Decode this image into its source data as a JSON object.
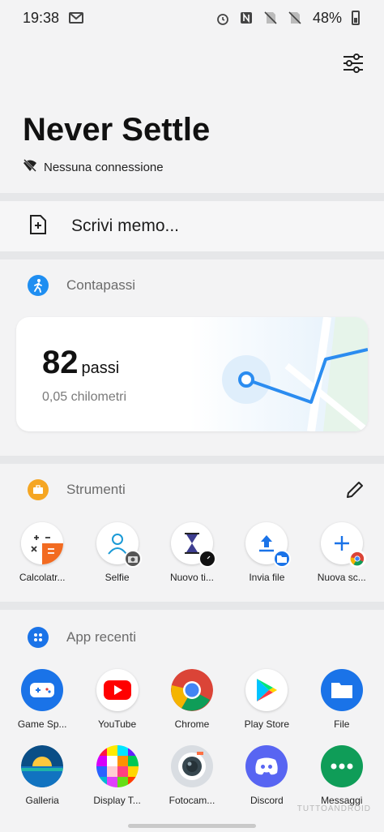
{
  "status_bar": {
    "time": "19:38",
    "battery": "48%",
    "icons": [
      "gmail-icon",
      "alarm-icon",
      "nfc-icon",
      "no-sim-icon",
      "no-sim-icon",
      "battery-icon"
    ]
  },
  "header": {
    "title": "Never Settle",
    "wifi_status": "Nessuna connessione"
  },
  "memo": {
    "label": "Scrivi memo..."
  },
  "steps": {
    "section_title": "Contapassi",
    "count": "82",
    "unit": "passi",
    "distance": "0,05 chilometri"
  },
  "tools": {
    "section_title": "Strumenti",
    "items": [
      {
        "label": "Calcolatr...",
        "icon": "calculator-icon"
      },
      {
        "label": "Selfie",
        "icon": "selfie-icon"
      },
      {
        "label": "Nuovo ti...",
        "icon": "timer-icon"
      },
      {
        "label": "Invia file",
        "icon": "send-file-icon"
      },
      {
        "label": "Nuova sc...",
        "icon": "new-tab-icon"
      }
    ]
  },
  "recent_apps": {
    "section_title": "App recenti",
    "row1": [
      {
        "label": "Game Sp...",
        "icon": "game-space-icon"
      },
      {
        "label": "YouTube",
        "icon": "youtube-icon"
      },
      {
        "label": "Chrome",
        "icon": "chrome-icon"
      },
      {
        "label": "Play Store",
        "icon": "play-store-icon"
      },
      {
        "label": "File",
        "icon": "file-icon"
      }
    ],
    "row2": [
      {
        "label": "Galleria",
        "icon": "gallery-icon"
      },
      {
        "label": "Display T...",
        "icon": "display-test-icon"
      },
      {
        "label": "Fotocam...",
        "icon": "camera-icon"
      },
      {
        "label": "Discord",
        "icon": "discord-icon"
      },
      {
        "label": "Messaggi",
        "icon": "messages-icon"
      }
    ]
  },
  "watermark": "TUTTOANDROID",
  "colors": {
    "accent_blue": "#1a73e8",
    "steps_blue": "#1f8ef1",
    "tools_orange": "#f5a623"
  }
}
